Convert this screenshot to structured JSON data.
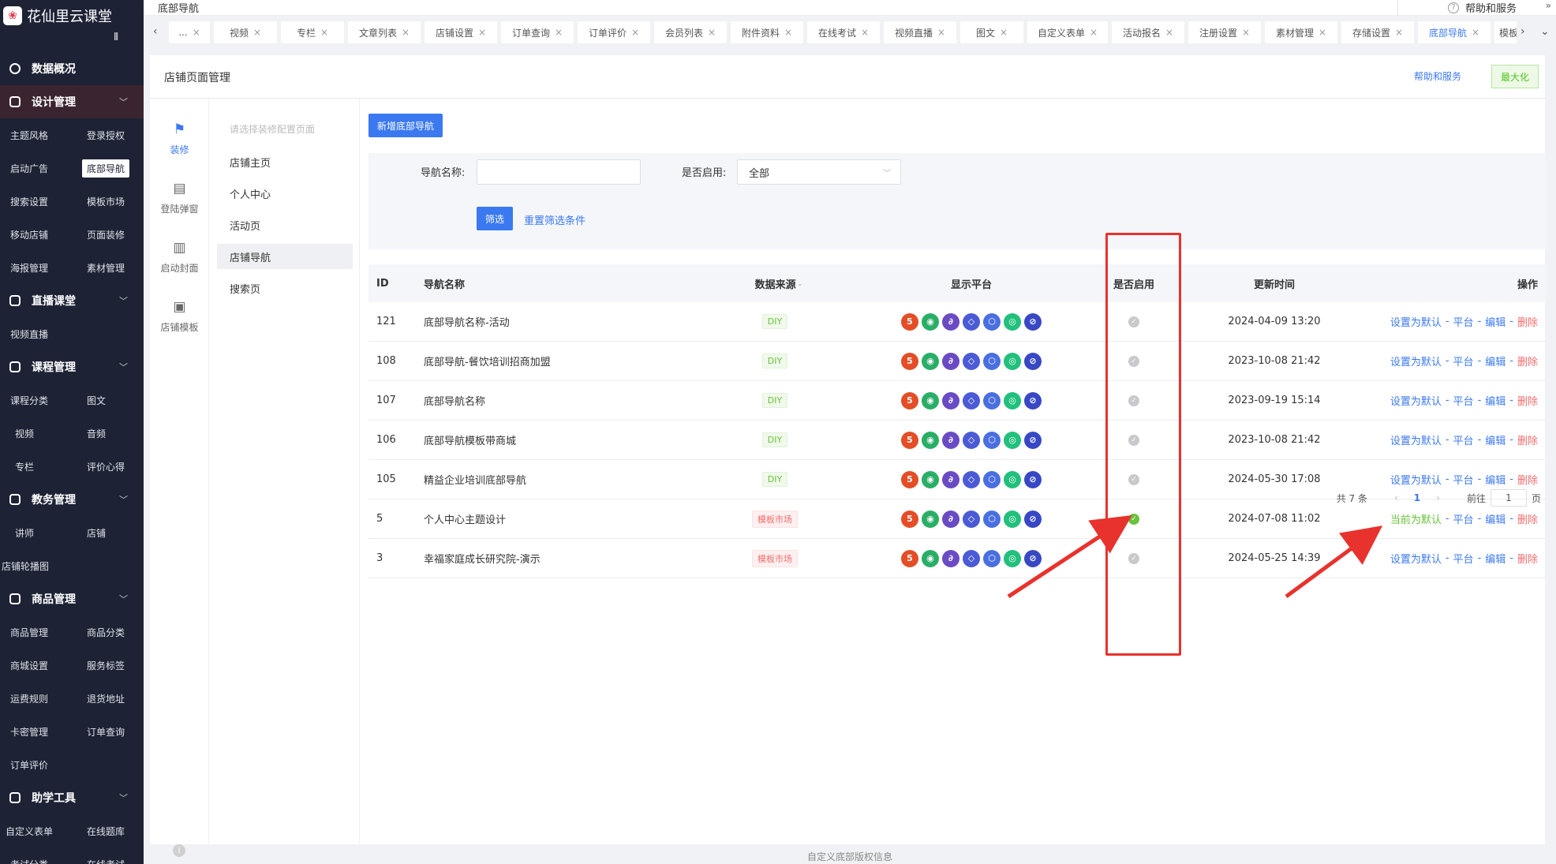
{
  "brand": {
    "name": "花仙里云课堂",
    "logo_icon": "flower-logo-icon"
  },
  "sidebar": {
    "collapse_icon": "collapse-icon",
    "sections": [
      {
        "label": "数据概况",
        "icon": "dashboard-icon",
        "items": []
      },
      {
        "label": "设计管理",
        "icon": "design-icon",
        "items": [
          "主题风格",
          "登录授权",
          "启动广告",
          "底部导航",
          "搜索设置",
          "模板市场",
          "移动店铺",
          "页面装修",
          "海报管理",
          "素材管理"
        ]
      },
      {
        "label": "直播课堂",
        "icon": "live-icon",
        "items": [
          "视频直播"
        ]
      },
      {
        "label": "课程管理",
        "icon": "course-icon",
        "items": [
          "课程分类",
          "图文",
          "视频",
          "音频",
          "专栏",
          "评价心得"
        ]
      },
      {
        "label": "教务管理",
        "icon": "academic-icon",
        "items": [
          "讲师",
          "店铺",
          "店铺轮播图"
        ]
      },
      {
        "label": "商品管理",
        "icon": "goods-icon",
        "items": [
          "商品管理",
          "商品分类",
          "商城设置",
          "服务标签",
          "运费规则",
          "退货地址",
          "卡密管理",
          "订单查询",
          "订单评价"
        ]
      },
      {
        "label": "助学工具",
        "icon": "tools-icon",
        "items": [
          "自定义表单",
          "在线题库",
          "考试分类",
          "在线考试"
        ]
      }
    ],
    "selected_item": "底部导航"
  },
  "topbar": {
    "breadcrumb": "底部导航",
    "help": "帮助和服务",
    "expand_icon": "double-chevron-icon"
  },
  "tabs": [
    {
      "label": "..."
    },
    {
      "label": "视频"
    },
    {
      "label": "专栏"
    },
    {
      "label": "文章列表"
    },
    {
      "label": "店铺设置"
    },
    {
      "label": "订单查询"
    },
    {
      "label": "订单评价"
    },
    {
      "label": "会员列表"
    },
    {
      "label": "附件资料"
    },
    {
      "label": "在线考试"
    },
    {
      "label": "视频直播"
    },
    {
      "label": "图文"
    },
    {
      "label": "自定义表单"
    },
    {
      "label": "活动报名"
    },
    {
      "label": "注册设置"
    },
    {
      "label": "素材管理"
    },
    {
      "label": "存储设置"
    },
    {
      "label": "底部导航"
    },
    {
      "label": "模板市场"
    }
  ],
  "active_tab": "底部导航",
  "panel": {
    "title": "店铺页面管理",
    "help_link": "帮助和服务",
    "maximize": "最大化"
  },
  "iconnav": [
    {
      "label": "装修",
      "icon": "paint-roller-icon"
    },
    {
      "label": "登陆弹窗",
      "icon": "popup-icon"
    },
    {
      "label": "启动封面",
      "icon": "cover-icon"
    },
    {
      "label": "店铺模板",
      "icon": "template-icon"
    }
  ],
  "pagelist": {
    "hint": "请选择装修配置页面",
    "items": [
      "店铺主页",
      "个人中心",
      "活动页",
      "店铺导航",
      "搜索页"
    ],
    "active": "店铺导航"
  },
  "toolbar": {
    "add_label": "新增底部导航"
  },
  "filter": {
    "name_label": "导航名称:",
    "name_value": "",
    "enabled_label": "是否启用:",
    "enabled_value": "全部",
    "submit": "筛选",
    "reset": "重置筛选条件"
  },
  "table": {
    "headers": {
      "id": "ID",
      "name": "导航名称",
      "source": "数据来源",
      "platform": "显示平台",
      "enabled": "是否启用",
      "updated": "更新时间",
      "actions": "操作"
    },
    "rows": [
      {
        "id": "121",
        "name": "底部导航名称-活动",
        "source": "DIY",
        "enabled": false,
        "updated": "2024-04-09 13:20",
        "default_label": "设置为默认"
      },
      {
        "id": "108",
        "name": "底部导航-餐饮培训招商加盟",
        "source": "DIY",
        "enabled": false,
        "updated": "2023-10-08 21:42",
        "default_label": "设置为默认"
      },
      {
        "id": "107",
        "name": "底部导航名称",
        "source": "DIY",
        "enabled": false,
        "updated": "2023-09-19 15:14",
        "default_label": "设置为默认"
      },
      {
        "id": "106",
        "name": "底部导航模板带商城",
        "source": "DIY",
        "enabled": false,
        "updated": "2023-10-08 21:42",
        "default_label": "设置为默认"
      },
      {
        "id": "105",
        "name": "精益企业培训底部导航",
        "source": "DIY",
        "enabled": false,
        "updated": "2024-05-30 17:08",
        "default_label": "设置为默认"
      },
      {
        "id": "5",
        "name": "个人中心主题设计",
        "source": "模板市场",
        "enabled": true,
        "updated": "2024-07-08 11:02",
        "default_label": "当前为默认"
      },
      {
        "id": "3",
        "name": "幸福家庭成长研究院-演示",
        "source": "模板市场",
        "enabled": false,
        "updated": "2024-05-25 14:39",
        "default_label": "设置为默认"
      }
    ],
    "platform_icons": [
      "h5-icon",
      "wechat-icon",
      "link-icon",
      "alipay-icon",
      "baidu-icon",
      "douyin-icon",
      "toutiao-icon"
    ],
    "action_platform": "平台",
    "action_edit": "编辑",
    "action_delete": "删除",
    "action_sep": "-"
  },
  "pagination": {
    "total": "共 7 条",
    "current": "1",
    "goto_label": "前往",
    "goto_value": "1",
    "page_suffix": "页"
  },
  "footer": {
    "copyright": "自定义底部版权信息"
  },
  "colors": {
    "primary": "#3b79f0",
    "sidebar_bg": "#1d2235",
    "success": "#67c23a",
    "danger": "#f56c6c",
    "annotation": "#e8322d"
  }
}
